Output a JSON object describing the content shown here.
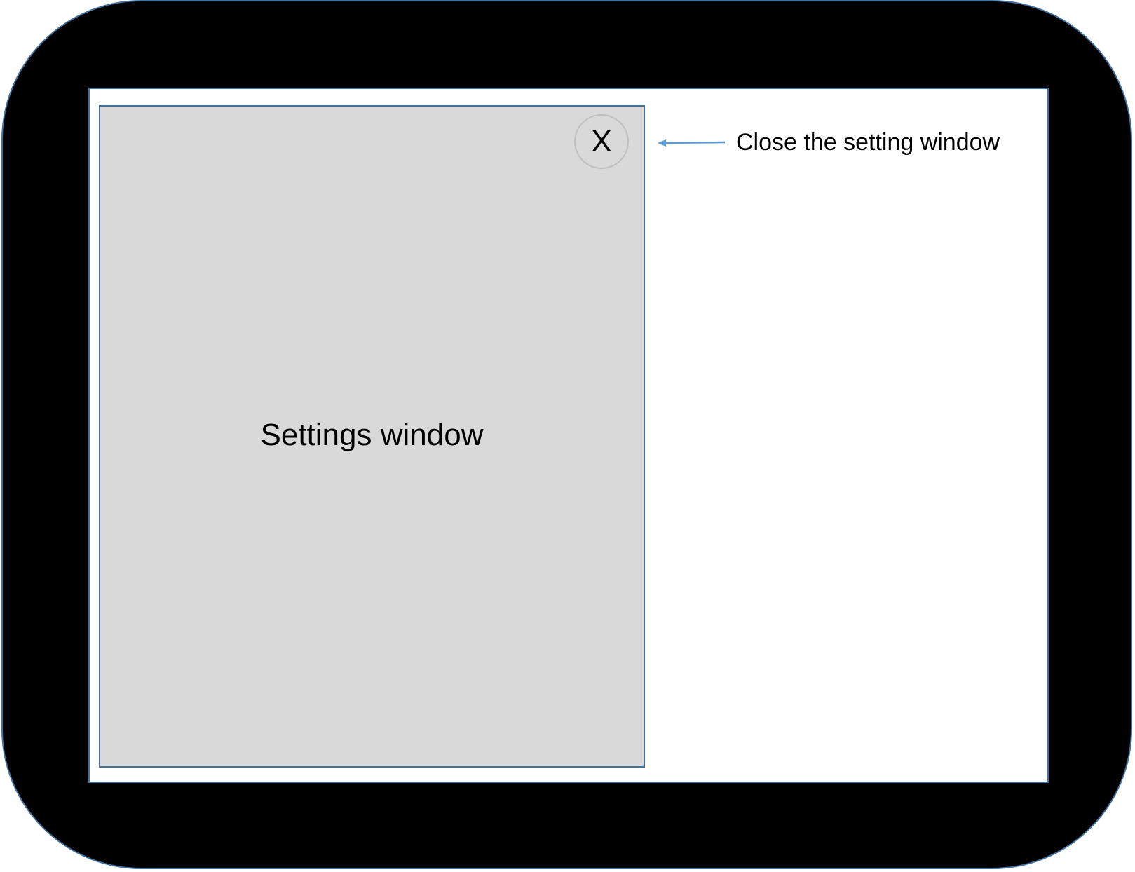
{
  "device": {
    "frame_color": "#000000",
    "border_color": "#41719c"
  },
  "settings_window": {
    "label": "Settings window",
    "background": "#d9d9d9",
    "close_button": {
      "label": "X",
      "icon": "close-icon"
    }
  },
  "annotation": {
    "text": "Close the setting window",
    "arrow_color": "#5b9bd5"
  }
}
